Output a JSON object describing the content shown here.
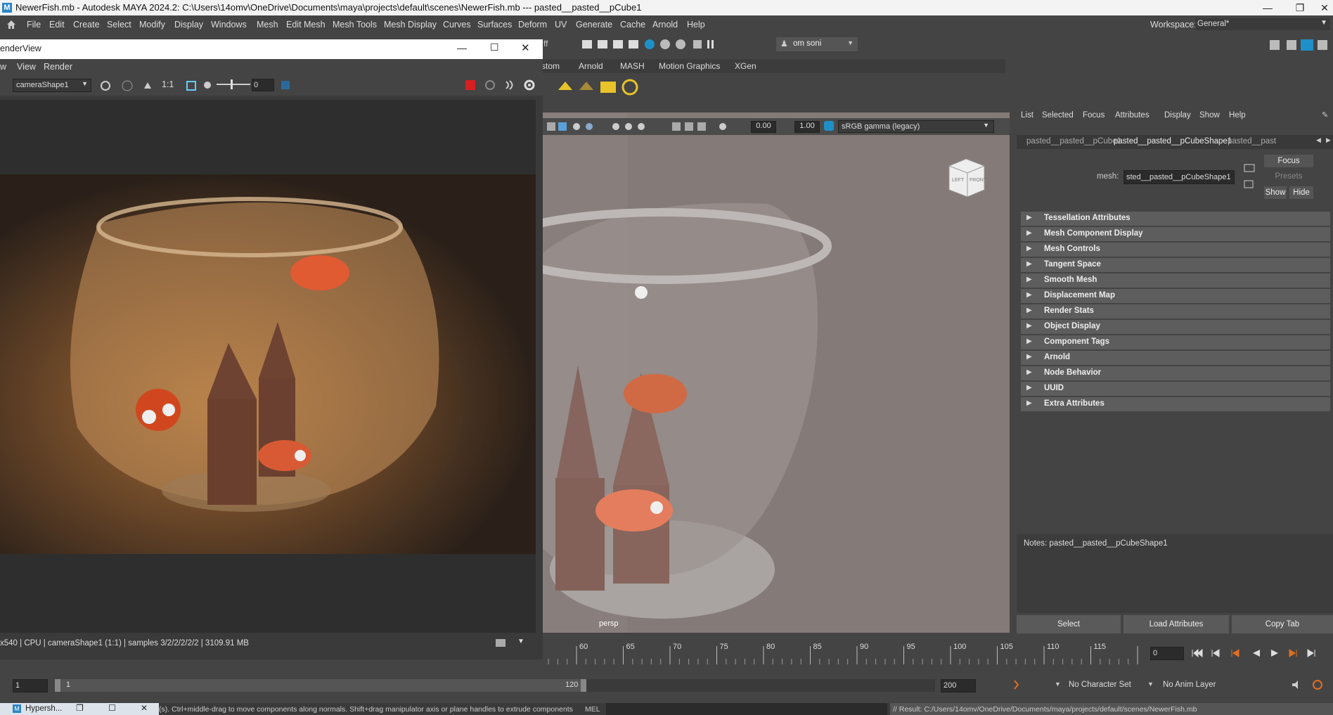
{
  "window": {
    "title": "NewerFish.mb - Autodesk MAYA 2024.2: C:\\Users\\14omv\\OneDrive\\Documents\\maya\\projects\\default\\scenes\\NewerFish.mb   ---   pasted__pasted__pCube1",
    "logo": "M"
  },
  "menu": [
    "File",
    "Edit",
    "Create",
    "Select",
    "Modify",
    "Display",
    "Windows",
    "Mesh",
    "Edit Mesh",
    "Mesh Tools",
    "Mesh Display",
    "Curves",
    "Surfaces",
    "Deform",
    "UV",
    "Generate",
    "Cache",
    "Arnold",
    "Help"
  ],
  "workspace": {
    "label": "Workspace:",
    "value": "General*"
  },
  "user": "om soni",
  "shelf": {
    "partial_tab": "stom",
    "tabs": [
      "Arnold",
      "MASH",
      "Motion Graphics",
      "XGen"
    ],
    "partial_left": "ff"
  },
  "render_view": {
    "title": "enderView",
    "menu": [
      "w",
      "View",
      "Render"
    ],
    "camera": "cameraShape1",
    "ratio": "1:1",
    "exposure": "0",
    "status": "x540 | CPU | cameraShape1 (1:1) | samples 3/2/2/2/2/2 | 3109.91 MB"
  },
  "viewport": {
    "gamma": "sRGB gamma (legacy)",
    "value1": "0.00",
    "value2": "1.00",
    "camera": "persp",
    "cube_labels": [
      "LEFT",
      "FRONT"
    ]
  },
  "attribute_editor": {
    "menu": [
      "List",
      "Selected",
      "Focus",
      "Attributes",
      "Display",
      "Show",
      "Help"
    ],
    "tabs": [
      "pasted__pasted__pCube1",
      "pasted__pasted__pCubeShape1",
      "pasted__past"
    ],
    "mesh_label": "mesh:",
    "mesh_value": "sted__pasted__pCubeShape1",
    "focus": "Focus",
    "presets": "Presets",
    "show": "Show",
    "hide": "Hide",
    "sections": [
      "Tessellation Attributes",
      "Mesh Component Display",
      "Mesh Controls",
      "Tangent Space",
      "Smooth Mesh",
      "Displacement Map",
      "Render Stats",
      "Object Display",
      "Component Tags",
      "Arnold",
      "Node Behavior",
      "UUID",
      "Extra Attributes"
    ],
    "notes": "Notes:  pasted__pasted__pCubeShape1",
    "buttons": [
      "Select",
      "Load Attributes",
      "Copy Tab"
    ]
  },
  "timeline": {
    "ticks": [
      "60",
      "65",
      "70",
      "75",
      "80",
      "85",
      "90",
      "95",
      "100",
      "105",
      "110",
      "115",
      "120"
    ],
    "current_frame": "0"
  },
  "range": {
    "start": "1",
    "inner_start": "1",
    "inner_end": "120",
    "end": "200",
    "character_set": "No Character Set",
    "anim_layer": "No Anim Layer"
  },
  "command": {
    "help": "(s). Ctrl+middle-drag to move components along normals. Shift+drag manipulator axis or plane handles to extrude components or c",
    "mel": "MEL",
    "result": "// Result: C:/Users/14omv/OneDrive/Documents/maya/projects/default/scenes/NewerFish.mb"
  },
  "hypershade": {
    "title": "Hypersh..."
  }
}
